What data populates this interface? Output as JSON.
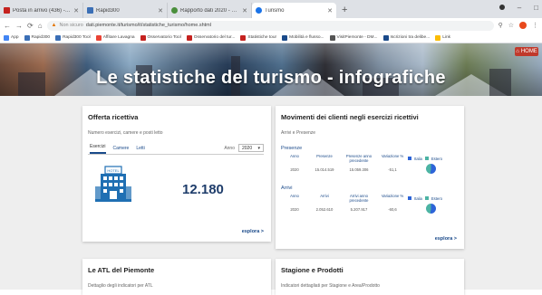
{
  "browser": {
    "tabs": [
      {
        "title": "Posta in arrivo (436) - fivefriend...",
        "fav": "#c5221f"
      },
      {
        "title": "Rapid300",
        "fav": "#3b6fb6"
      },
      {
        "title": "Rapporto dati 2020 - VisitPiemonte",
        "fav": "#4a8f3c"
      },
      {
        "title": "Turismo",
        "fav": "#1a73e8"
      }
    ],
    "new_tab_label": "+",
    "address": {
      "warning": "▲",
      "security": "Non sicuro",
      "url": "dati.piemonte.it/turismo/it/statistiche_turismo/home.shtml"
    },
    "bookmarks": [
      {
        "label": "App",
        "color": "#4285f4"
      },
      {
        "label": "Rapid300",
        "color": "#3b6fb6"
      },
      {
        "label": "Rapid300 Tool",
        "color": "#3b6fb6"
      },
      {
        "label": "Affitare Lavagna",
        "color": "#ea4335"
      },
      {
        "label": "Osservatorio Tool",
        "color": "#c5221f"
      },
      {
        "label": "Osservatorio del tur...",
        "color": "#c5221f"
      },
      {
        "label": "Statistiche tour",
        "color": "#c5221f"
      },
      {
        "label": "Mobilità e flusso...",
        "color": "#1a4a8a"
      },
      {
        "label": "VisitPiemonte - DM...",
        "color": "#555555"
      },
      {
        "label": "Iscrizioni tra delibe...",
        "color": "#1a4a8a"
      },
      {
        "label": "Link",
        "color": "#fbbc04"
      }
    ]
  },
  "banner": {
    "title": "Le statistiche del turismo - infografiche",
    "home_button": "HOME"
  },
  "offerta": {
    "title": "Offerta ricettiva",
    "subtitle": "Numero esercizi, camere e posti letto",
    "tabs": [
      "Esercizi",
      "Camere",
      "Letti"
    ],
    "year_label": "Anno",
    "year_value": "2020",
    "value": "12.180",
    "more": "esplora >"
  },
  "movimenti": {
    "title": "Movimenti dei clienti negli esercizi ricettivi",
    "subtitle": "Arrivi e Presenze",
    "presenze": {
      "heading": "Presenze",
      "headers": [
        "Anno",
        "Presenze",
        "Presenze anno precedente",
        "Variazione %"
      ],
      "values": [
        "2020",
        "15.014.519",
        "15.059.306",
        "-51,1"
      ]
    },
    "arrivi": {
      "heading": "Arrivi",
      "headers": [
        "Anno",
        "Arrivi",
        "Arrivi anno precedente",
        "Variazione %"
      ],
      "values": [
        "2020",
        "2.052.610",
        "5.207.917",
        "-60,6"
      ]
    },
    "legend": {
      "italia": "Italia",
      "estero": "Estero",
      "italia_color": "#2d64d8",
      "estero_color": "#4cb3a4"
    },
    "more": "esplora >"
  },
  "atl": {
    "title": "Le ATL del Piemonte",
    "subtitle": "Dettaglio degli indicatori per ATL"
  },
  "stagione": {
    "title": "Stagione e Prodotti",
    "subtitle": "Indicatori dettagliati per Stagione e Area/Prodotto"
  }
}
